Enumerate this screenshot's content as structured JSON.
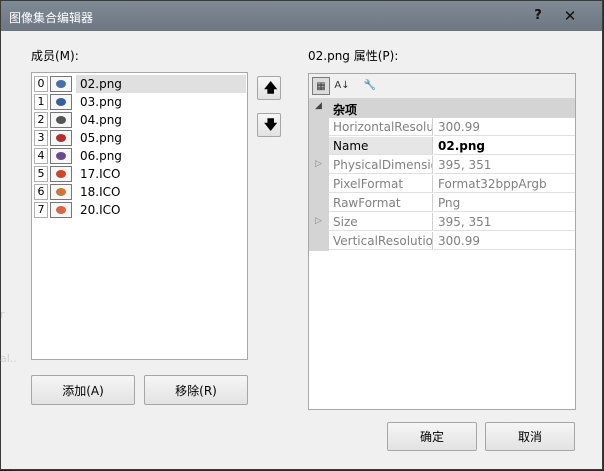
{
  "window": {
    "title": "图像集合编辑器",
    "help_label": "?",
    "close_label": "✕"
  },
  "background_fragments": [
    "r",
    "al.."
  ],
  "members": {
    "label": "成员(M):",
    "items": [
      {
        "index": "0",
        "name": "02.png",
        "selected": true,
        "color": "#4a6fa5"
      },
      {
        "index": "1",
        "name": "03.png",
        "selected": false,
        "color": "#3a5f9a"
      },
      {
        "index": "2",
        "name": "04.png",
        "selected": false,
        "color": "#555555"
      },
      {
        "index": "3",
        "name": "05.png",
        "selected": false,
        "color": "#b03030"
      },
      {
        "index": "4",
        "name": "06.png",
        "selected": false,
        "color": "#6a4a8a"
      },
      {
        "index": "5",
        "name": "17.ICO",
        "selected": false,
        "color": "#c84a2a"
      },
      {
        "index": "6",
        "name": "18.ICO",
        "selected": false,
        "color": "#c8783a"
      },
      {
        "index": "7",
        "name": "20.ICO",
        "selected": false,
        "color": "#d8664a"
      }
    ],
    "up_label": "🡅",
    "down_label": "🡇",
    "add_label": "添加(A)",
    "remove_label": "移除(R)"
  },
  "properties": {
    "label": "02.png 属性(P):",
    "toolbar": {
      "categorized_label": "▦",
      "alphabetical_label": "A↓",
      "pages_label": "🔧"
    },
    "category": {
      "label": "杂项",
      "arrow": "◢"
    },
    "rows": [
      {
        "name": "HorizontalResolution",
        "value": "300.99",
        "expandable": false,
        "selected": false
      },
      {
        "name": "Name",
        "value": "02.png",
        "expandable": false,
        "selected": true
      },
      {
        "name": "PhysicalDimension",
        "value": "395, 351",
        "expandable": true,
        "selected": false
      },
      {
        "name": "PixelFormat",
        "value": "Format32bppArgb",
        "expandable": false,
        "selected": false
      },
      {
        "name": "RawFormat",
        "value": "Png",
        "expandable": false,
        "selected": false
      },
      {
        "name": "Size",
        "value": "395, 351",
        "expandable": true,
        "selected": false
      },
      {
        "name": "VerticalResolution",
        "value": "300.99",
        "expandable": false,
        "selected": false
      }
    ],
    "expand_glyph": "▷"
  },
  "footer": {
    "ok_label": "确定",
    "cancel_label": "取消"
  }
}
